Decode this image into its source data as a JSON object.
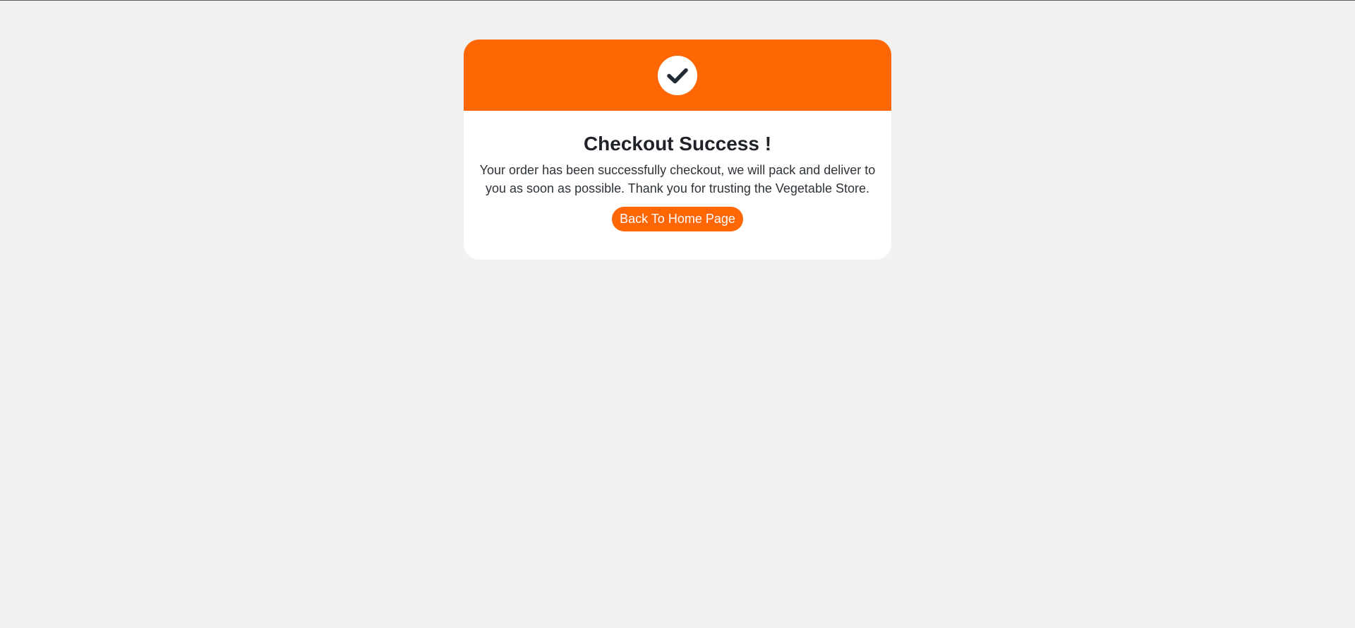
{
  "colors": {
    "accent": "#ff6604",
    "background": "#f1f1f1",
    "card": "#ffffff",
    "icon": "#1f2a36",
    "title": "#1f2329"
  },
  "header": {
    "icon": "checkmark-icon"
  },
  "content": {
    "title": "Checkout Success !",
    "message": "Your order has been successfully checkout, we will pack and deliver to you as soon as possible. Thank you for trusting the Vegetable Store.",
    "button_label": "Back To Home Page"
  }
}
